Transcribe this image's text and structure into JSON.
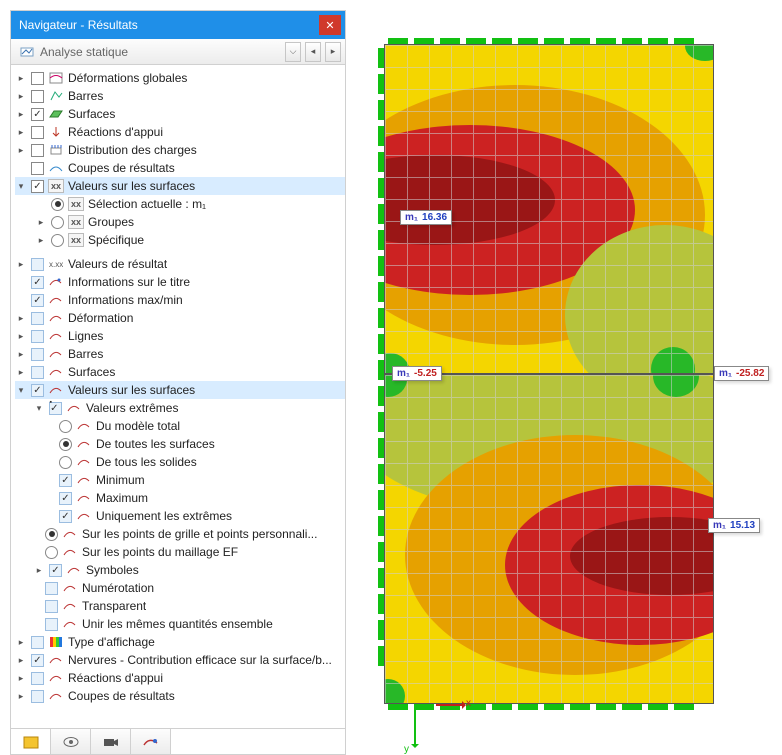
{
  "window": {
    "title": "Navigateur - Résultats"
  },
  "toolbar": {
    "mode": "Analyse statique"
  },
  "annotations": {
    "top_max": {
      "label": "m₁",
      "value": "16.36"
    },
    "mid_left": {
      "label": "m₁",
      "value": "-5.25"
    },
    "mid_right": {
      "label": "m₁",
      "value": "-25.82"
    },
    "bot_max": {
      "label": "m₁",
      "value": "15.13"
    },
    "axis_x": "x",
    "axis_y": "y"
  },
  "tree": {
    "block1": [
      {
        "label": "Déformations globales"
      },
      {
        "label": "Barres"
      },
      {
        "label": "Surfaces"
      },
      {
        "label": "Réactions d'appui"
      },
      {
        "label": "Distribution des charges"
      },
      {
        "label": "Coupes de résultats"
      }
    ],
    "values_surfaces_group": {
      "label": "Valeurs sur les surfaces",
      "children": {
        "selection": "Sélection actuelle : m₁",
        "groupes": "Groupes",
        "specifique": "Spécifique"
      }
    },
    "block2": [
      "Valeurs de résultat",
      "Informations sur le titre",
      "Informations max/min",
      "Déformation",
      "Lignes",
      "Barres",
      "Surfaces"
    ],
    "vs2": {
      "label": "Valeurs sur les surfaces",
      "extremes": {
        "label": "Valeurs extrêmes",
        "opts": [
          "Du modèle total",
          "De toutes les surfaces",
          "De tous les solides"
        ],
        "chks": [
          "Minimum",
          "Maximum",
          "Uniquement les extrêmes"
        ]
      },
      "radios": [
        "Sur les points de grille et points personnali...",
        "Sur les points du maillage EF"
      ],
      "tail": [
        "Symboles",
        "Numérotation",
        "Transparent",
        "Unir les mêmes quantités ensemble"
      ]
    },
    "block3": [
      "Type d'affichage",
      "Nervures - Contribution efficace sur la surface/b...",
      "Réactions d'appui",
      "Coupes de résultats"
    ]
  }
}
